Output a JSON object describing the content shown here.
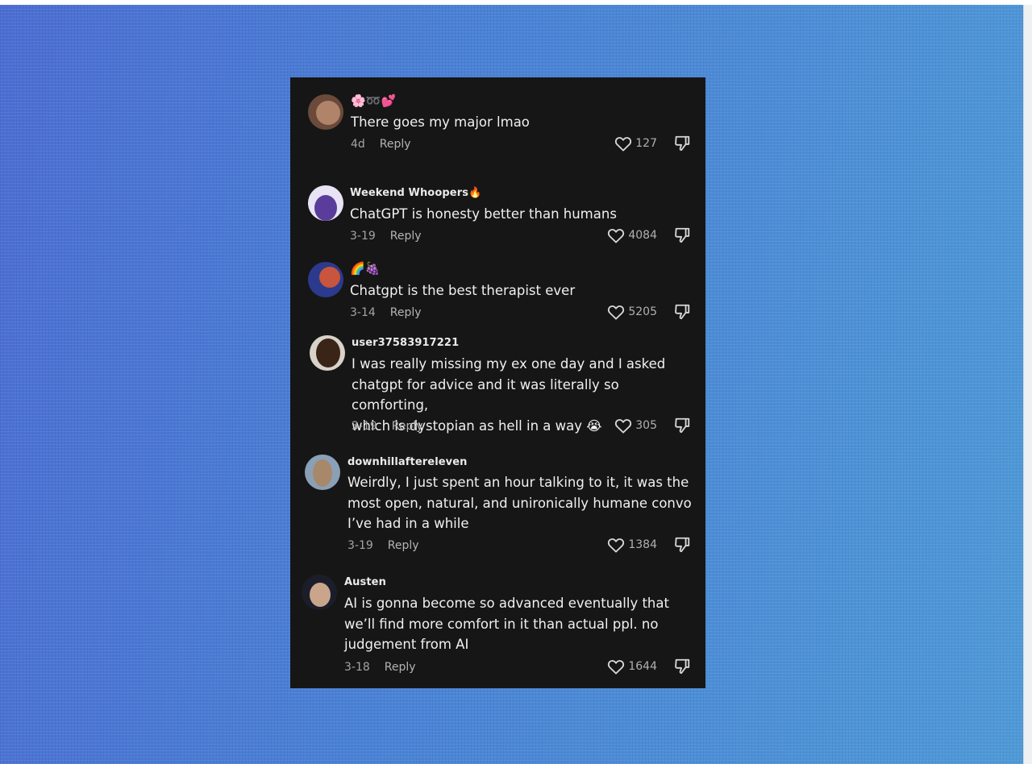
{
  "comments": [
    {
      "username": "🌸➿💕",
      "text": "There goes my major lmao",
      "date": "4d",
      "reply_label": "Reply",
      "likes": "127",
      "avatar_colors": [
        "#6a4a3a",
        "#b08468"
      ]
    },
    {
      "username": "Weekend Whoopers🔥",
      "text": "ChatGPT is honesty better than humans",
      "date": "3-19",
      "reply_label": "Reply",
      "likes": "4084",
      "avatar_colors": [
        "#e9e4f5",
        "#5a3d9a"
      ]
    },
    {
      "username": "🌈🍇",
      "text": "Chatgpt is the best therapist ever",
      "date": "3-14",
      "reply_label": "Reply",
      "likes": "5205",
      "avatar_colors": [
        "#2b3a8c",
        "#c8553d"
      ]
    },
    {
      "username": "user37583917221",
      "text": "I was really missing my ex one day and I asked\nchatgpt for advice and it was literally so comforting,\nwhich is dystopian as hell in a way 😭",
      "date": "3-19",
      "reply_label": "Reply",
      "likes": "305",
      "avatar_colors": [
        "#d8d2c8",
        "#3a2418"
      ]
    },
    {
      "username": "downhillaftereleven",
      "text": "Weirdly, I just spent an hour talking to it, it was the\nmost open, natural, and unironically humane convo\nI’ve had in a while",
      "date": "3-19",
      "reply_label": "Reply",
      "likes": "1384",
      "avatar_colors": [
        "#8aa0b6",
        "#a8886a"
      ]
    },
    {
      "username": "Austen",
      "text": "AI is gonna become so advanced eventually that\nwe’ll find more comfort in it than actual ppl. no\njudgement from AI",
      "date": "3-18",
      "reply_label": "Reply",
      "likes": "1644",
      "avatar_colors": [
        "#1b1e2a",
        "#c9a58c"
      ]
    }
  ]
}
